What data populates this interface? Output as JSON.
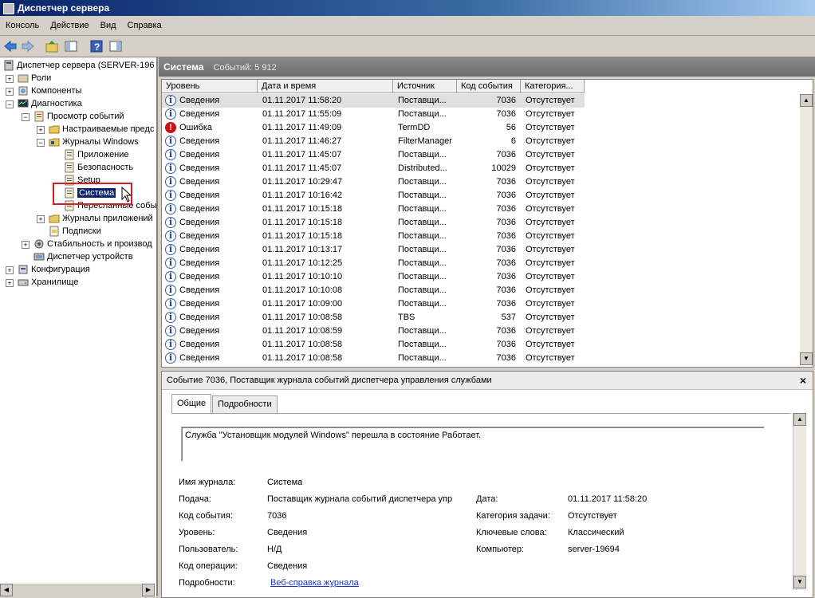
{
  "window": {
    "title": "Диспетчер сервера"
  },
  "menu": [
    "Консоль",
    "Действие",
    "Вид",
    "Справка"
  ],
  "tree": {
    "root": "Диспетчер сервера (SERVER-196",
    "roles": "Роли",
    "components": "Компоненты",
    "diagnostics": "Диагностика",
    "event_viewer": "Просмотр событий",
    "custom_views": "Настраиваемые предс",
    "windows_logs": "Журналы Windows",
    "app": "Приложение",
    "security": "Безопасность",
    "setup": "Setup",
    "system": "Система",
    "forwarded": "Пересланные собы",
    "app_logs": "Журналы приложений",
    "subscriptions": "Подписки",
    "stability": "Стабильность и производ",
    "device_manager": "Диспетчер устройств",
    "configuration": "Конфигурация",
    "storage": "Хранилище"
  },
  "panel": {
    "title": "Система",
    "count": "Событий: 5 912"
  },
  "columns": [
    "Уровень",
    "Дата и время",
    "Источник",
    "Код события",
    "Категория..."
  ],
  "rows": [
    {
      "icon": "info",
      "level": "Сведения",
      "datetime": "01.11.2017 11:58:20",
      "source": "Поставщи...",
      "code": "7036",
      "category": "Отсутствует"
    },
    {
      "icon": "info",
      "level": "Сведения",
      "datetime": "01.11.2017 11:55:09",
      "source": "Поставщи...",
      "code": "7036",
      "category": "Отсутствует"
    },
    {
      "icon": "error",
      "level": "Ошибка",
      "datetime": "01.11.2017 11:49:09",
      "source": "TermDD",
      "code": "56",
      "category": "Отсутствует"
    },
    {
      "icon": "info",
      "level": "Сведения",
      "datetime": "01.11.2017 11:46:27",
      "source": "FilterManager",
      "code": "6",
      "category": "Отсутствует"
    },
    {
      "icon": "info",
      "level": "Сведения",
      "datetime": "01.11.2017 11:45:07",
      "source": "Поставщи...",
      "code": "7036",
      "category": "Отсутствует"
    },
    {
      "icon": "info",
      "level": "Сведения",
      "datetime": "01.11.2017 11:45:07",
      "source": "Distributed...",
      "code": "10029",
      "category": "Отсутствует"
    },
    {
      "icon": "info",
      "level": "Сведения",
      "datetime": "01.11.2017 10:29:47",
      "source": "Поставщи...",
      "code": "7036",
      "category": "Отсутствует"
    },
    {
      "icon": "info",
      "level": "Сведения",
      "datetime": "01.11.2017 10:16:42",
      "source": "Поставщи...",
      "code": "7036",
      "category": "Отсутствует"
    },
    {
      "icon": "info",
      "level": "Сведения",
      "datetime": "01.11.2017 10:15:18",
      "source": "Поставщи...",
      "code": "7036",
      "category": "Отсутствует"
    },
    {
      "icon": "info",
      "level": "Сведения",
      "datetime": "01.11.2017 10:15:18",
      "source": "Поставщи...",
      "code": "7036",
      "category": "Отсутствует"
    },
    {
      "icon": "info",
      "level": "Сведения",
      "datetime": "01.11.2017 10:15:18",
      "source": "Поставщи...",
      "code": "7036",
      "category": "Отсутствует"
    },
    {
      "icon": "info",
      "level": "Сведения",
      "datetime": "01.11.2017 10:13:17",
      "source": "Поставщи...",
      "code": "7036",
      "category": "Отсутствует"
    },
    {
      "icon": "info",
      "level": "Сведения",
      "datetime": "01.11.2017 10:12:25",
      "source": "Поставщи...",
      "code": "7036",
      "category": "Отсутствует"
    },
    {
      "icon": "info",
      "level": "Сведения",
      "datetime": "01.11.2017 10:10:10",
      "source": "Поставщи...",
      "code": "7036",
      "category": "Отсутствует"
    },
    {
      "icon": "info",
      "level": "Сведения",
      "datetime": "01.11.2017 10:10:08",
      "source": "Поставщи...",
      "code": "7036",
      "category": "Отсутствует"
    },
    {
      "icon": "info",
      "level": "Сведения",
      "datetime": "01.11.2017 10:09:00",
      "source": "Поставщи...",
      "code": "7036",
      "category": "Отсутствует"
    },
    {
      "icon": "info",
      "level": "Сведения",
      "datetime": "01.11.2017 10:08:58",
      "source": "TBS",
      "code": "537",
      "category": "Отсутствует"
    },
    {
      "icon": "info",
      "level": "Сведения",
      "datetime": "01.11.2017 10:08:59",
      "source": "Поставщи...",
      "code": "7036",
      "category": "Отсутствует"
    },
    {
      "icon": "info",
      "level": "Сведения",
      "datetime": "01.11.2017 10:08:58",
      "source": "Поставщи...",
      "code": "7036",
      "category": "Отсутствует"
    },
    {
      "icon": "info",
      "level": "Сведения",
      "datetime": "01.11.2017 10:08:58",
      "source": "Поставщи...",
      "code": "7036",
      "category": "Отсутствует"
    }
  ],
  "detail": {
    "title": "Событие 7036, Поставщик журнала событий диспетчера управления службами",
    "close": "×",
    "tabs": [
      "Общие",
      "Подробности"
    ],
    "description": "Служба \"Установщик модулей Windows\" перешла в состояние Работает.",
    "log_name_label": "Имя журнала:",
    "log_name": "Система",
    "source_label": "Подача:",
    "source": "Поставщик журнала событий диспетчера упр",
    "event_id_label": "Код события:",
    "event_id": "7036",
    "level_label": "Уровень:",
    "level": "Сведения",
    "user_label": "Пользователь:",
    "user": "Н/Д",
    "opcode_label": "Код операции:",
    "opcode": "Сведения",
    "more_label": "Подробности:",
    "more_link": "Веб-справка журнала",
    "date_label": "Дата:",
    "date": "01.11.2017 11:58:20",
    "task_label": "Категория задачи:",
    "task": "Отсутствует",
    "keywords_label": "Ключевые слова:",
    "keywords": "Классический",
    "computer_label": "Компьютер:",
    "computer": "server-19694"
  }
}
